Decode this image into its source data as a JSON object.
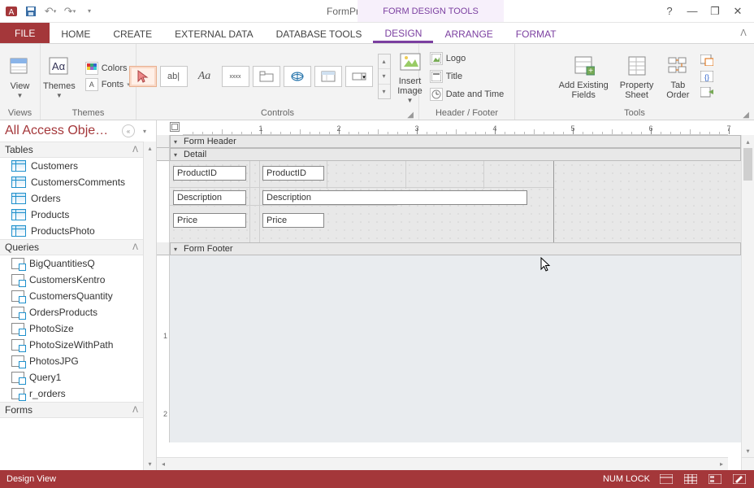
{
  "titlebar": {
    "title": "FormProducts - Access",
    "contextual": "FORM DESIGN TOOLS"
  },
  "tabs": {
    "file": "FILE",
    "home": "HOME",
    "create": "CREATE",
    "external": "EXTERNAL DATA",
    "dbtools": "DATABASE TOOLS",
    "design": "DESIGN",
    "arrange": "ARRANGE",
    "format": "FORMAT"
  },
  "ribbon": {
    "views": {
      "view": "View",
      "group": "Views"
    },
    "themes": {
      "themes": "Themes",
      "colors": "Colors",
      "fonts": "Fonts",
      "group": "Themes"
    },
    "controls": {
      "select_tool": "↖",
      "textbox": "ab|",
      "label": "Aa",
      "button": "xxxx",
      "group": "Controls"
    },
    "insert_image": "Insert\nImage",
    "headerfooter": {
      "logo": "Logo",
      "title": "Title",
      "datetime": "Date and Time",
      "group": "Header / Footer"
    },
    "tools": {
      "addfields": "Add Existing\nFields",
      "propsheet": "Property\nSheet",
      "taborder": "Tab\nOrder",
      "group": "Tools"
    }
  },
  "nav": {
    "title": "All Access Obje…",
    "groups": {
      "tables": "Tables",
      "queries": "Queries",
      "forms": "Forms"
    },
    "tables": [
      "Customers",
      "CustomersComments",
      "Orders",
      "Products",
      "ProductsPhoto"
    ],
    "queries": [
      "BigQuantitiesQ",
      "CustomersKentro",
      "CustomersQuantity",
      "OrdersProducts",
      "PhotoSize",
      "PhotoSizeWithPath",
      "PhotosJPG",
      "Query1",
      "r_orders"
    ]
  },
  "design": {
    "sections": {
      "form_header": "Form Header",
      "detail": "Detail",
      "form_footer": "Form Footer"
    },
    "fields": {
      "productid_label": "ProductID",
      "productid_ctrl": "ProductID",
      "description_label": "Description",
      "description_ctrl": "Description",
      "price_label": "Price",
      "price_ctrl": "Price"
    },
    "ruler_labels": [
      "1",
      "2",
      "3",
      "4",
      "5",
      "6",
      "7"
    ]
  },
  "status": {
    "view": "Design View",
    "numlock": "NUM LOCK"
  }
}
